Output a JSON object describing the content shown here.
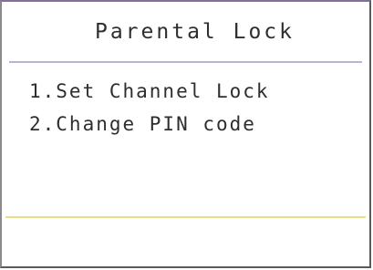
{
  "dialog": {
    "title": "Parental Lock",
    "menu_items": [
      {
        "label": "1.Set Channel Lock"
      },
      {
        "label": "2.Change PIN code"
      }
    ],
    "colors": {
      "text": "#2e2e2e",
      "top_divider": "#b9b4d6",
      "bottom_divider": "#e6e08a"
    }
  }
}
